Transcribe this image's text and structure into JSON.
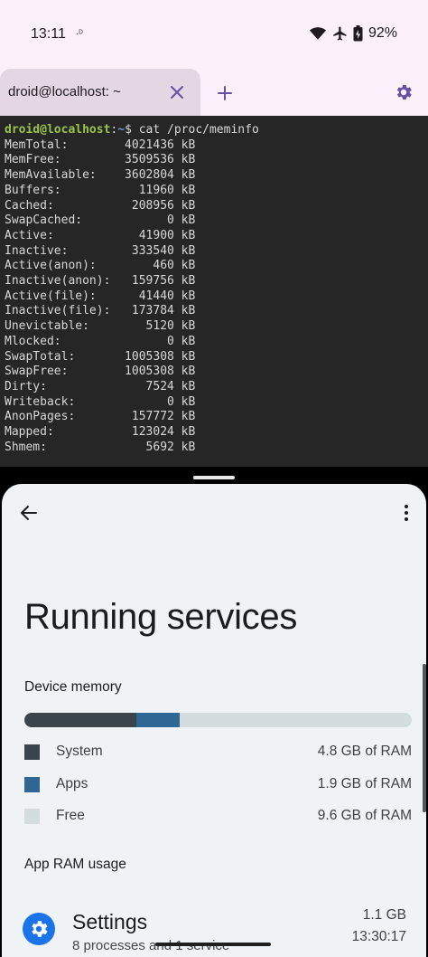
{
  "status_bar": {
    "time": "13:11",
    "notification_glyph": "·ᴰ",
    "battery": "92%",
    "icons": [
      "wifi-icon",
      "airplane-icon",
      "battery-charging-icon"
    ]
  },
  "terminal_app": {
    "tab_label": "droid@localhost: ~",
    "icons": [
      "close-icon",
      "add-icon",
      "gear-icon"
    ],
    "accent": "#6750a4",
    "prompt_user": "droid@localhost",
    "prompt_sep": ":",
    "prompt_path": "~",
    "prompt_symbol": "$ ",
    "command": "cat /proc/meminfo",
    "lines": [
      {
        "key": "MemTotal:",
        "value": "4021436 kB"
      },
      {
        "key": "MemFree:",
        "value": "3509536 kB"
      },
      {
        "key": "MemAvailable:",
        "value": "3602804 kB"
      },
      {
        "key": "Buffers:",
        "value": "11960 kB"
      },
      {
        "key": "Cached:",
        "value": "208956 kB"
      },
      {
        "key": "SwapCached:",
        "value": "0 kB"
      },
      {
        "key": "Active:",
        "value": "41900 kB"
      },
      {
        "key": "Inactive:",
        "value": "333540 kB"
      },
      {
        "key": "Active(anon):",
        "value": "460 kB"
      },
      {
        "key": "Inactive(anon):",
        "value": "159756 kB"
      },
      {
        "key": "Active(file):",
        "value": "41440 kB"
      },
      {
        "key": "Inactive(file):",
        "value": "173784 kB"
      },
      {
        "key": "Unevictable:",
        "value": "5120 kB"
      },
      {
        "key": "Mlocked:",
        "value": "0 kB"
      },
      {
        "key": "SwapTotal:",
        "value": "1005308 kB"
      },
      {
        "key": "SwapFree:",
        "value": "1005308 kB"
      },
      {
        "key": "Dirty:",
        "value": "7524 kB"
      },
      {
        "key": "Writeback:",
        "value": "0 kB"
      },
      {
        "key": "AnonPages:",
        "value": "157772 kB"
      },
      {
        "key": "Mapped:",
        "value": "123024 kB"
      },
      {
        "key": "Shmem:",
        "value": "5692 kB"
      }
    ]
  },
  "settings_app": {
    "icons": [
      "back-arrow-icon",
      "more-vert-icon"
    ],
    "title": "Running services",
    "device_memory": {
      "heading": "Device memory",
      "usage_fraction": {
        "system": 0.29,
        "apps": 0.11,
        "free": 0.6
      },
      "legend": [
        {
          "label": "System",
          "value": "4.8 GB of RAM",
          "color": "#3a444c"
        },
        {
          "label": "Apps",
          "value": "1.9 GB of RAM",
          "color": "#2f6694"
        },
        {
          "label": "Free",
          "value": "9.6 GB of RAM",
          "color": "#d3dcde"
        }
      ]
    },
    "app_ram": {
      "heading": "App RAM usage",
      "item": {
        "name": "Settings",
        "subtitle": "8 processes and 1 service",
        "size": "1.1 GB",
        "time": "13:30:17",
        "icon": "settings-app-icon",
        "icon_color": "#1a73e8"
      }
    }
  }
}
